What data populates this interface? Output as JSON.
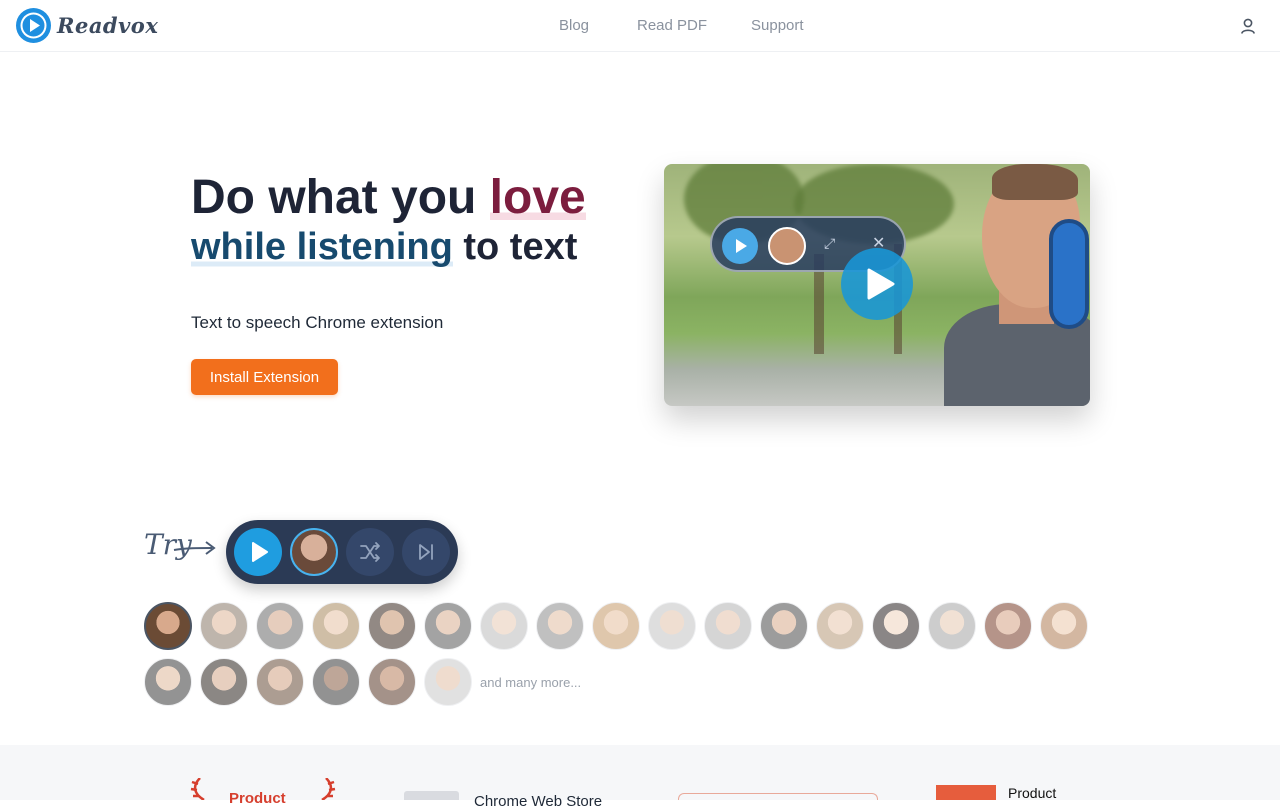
{
  "header": {
    "logo_text": "Readvox",
    "nav": [
      "Blog",
      "Read PDF",
      "Support"
    ]
  },
  "hero": {
    "title_part1": "Do what you ",
    "title_love": "love",
    "title_listening": "while listening",
    "title_part2": " to text",
    "subtitle": "Text to speech Chrome extension",
    "install_label": "Install Extension"
  },
  "try": {
    "label": "Try",
    "more_label": "and many more..."
  },
  "voices": {
    "row1_count": 17,
    "row2_count": 6,
    "selected_index": 0
  },
  "footer": {
    "product_hunt_text": "Product",
    "chrome_store_text": "Chrome Web Store",
    "product_text": "Product"
  },
  "colors": {
    "accent_orange": "#f26f1c",
    "brand_blue": "#1f8fe0",
    "love_color": "#7c1d3e",
    "listening_color": "#174a6e"
  }
}
